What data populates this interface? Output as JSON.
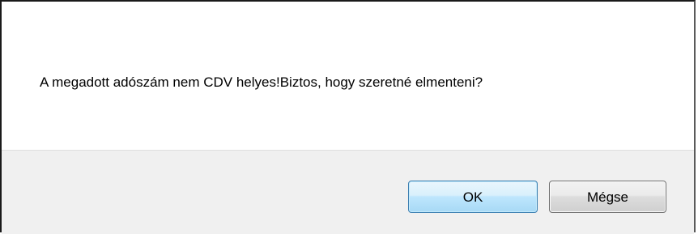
{
  "dialog": {
    "message": "A megadott adószám nem CDV helyes!Biztos, hogy szeretné elmenteni?",
    "buttons": {
      "ok_label": "OK",
      "cancel_label": "Mégse"
    }
  },
  "colors": {
    "content_background": "#ffffff",
    "button_bar_background": "#f0f0f0",
    "ok_border": "#3c7fb1",
    "cancel_border": "#707070"
  }
}
